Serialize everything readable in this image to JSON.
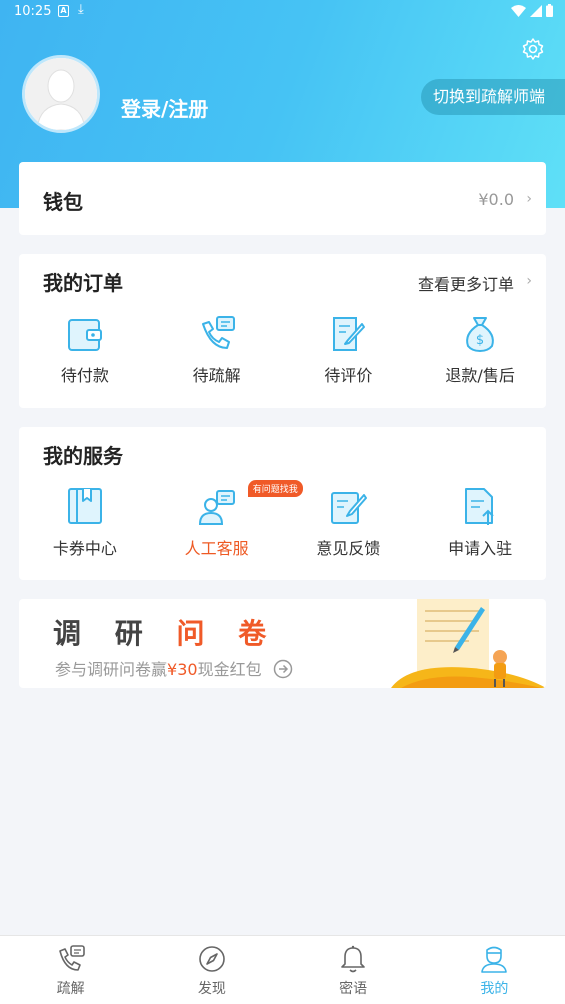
{
  "status_bar": {
    "time": "10:25",
    "notif_a": "A",
    "notif_download": "⤓"
  },
  "profile": {
    "login_label": "登录/注册",
    "switch_label": "切换到疏解师端"
  },
  "wallet": {
    "title": "钱包",
    "balance": "¥0.0"
  },
  "orders": {
    "title": "我的订单",
    "more_label": "查看更多订单",
    "items": [
      {
        "label": "待付款",
        "icon": "wallet-icon"
      },
      {
        "label": "待疏解",
        "icon": "phone-chat-icon"
      },
      {
        "label": "待评价",
        "icon": "edit-doc-icon"
      },
      {
        "label": "退款/售后",
        "icon": "money-bag-icon"
      }
    ]
  },
  "services": {
    "title": "我的服务",
    "items": [
      {
        "label": "卡券中心",
        "icon": "coupon-book-icon"
      },
      {
        "label": "人工客服",
        "icon": "customer-service-icon",
        "badge": "有问题找我"
      },
      {
        "label": "意见反馈",
        "icon": "feedback-edit-icon"
      },
      {
        "label": "申请入驻",
        "icon": "apply-doc-icon"
      }
    ]
  },
  "banner": {
    "title_normal": "调 研 ",
    "title_highlight": "问 卷",
    "subtitle_prefix": "参与调研问卷赢",
    "subtitle_amount": "¥30",
    "subtitle_suffix": "现金红包"
  },
  "tabbar": [
    {
      "label": "疏解",
      "icon": "phone-chat-icon"
    },
    {
      "label": "发现",
      "icon": "compass-icon"
    },
    {
      "label": "密语",
      "icon": "bell-icon"
    },
    {
      "label": "我的",
      "icon": "user-icon",
      "active": true
    }
  ],
  "colors": {
    "accent": "#3bb3e8",
    "highlight": "#f05a28",
    "header_start": "#3fb4f2",
    "header_end": "#5fe0f7"
  }
}
